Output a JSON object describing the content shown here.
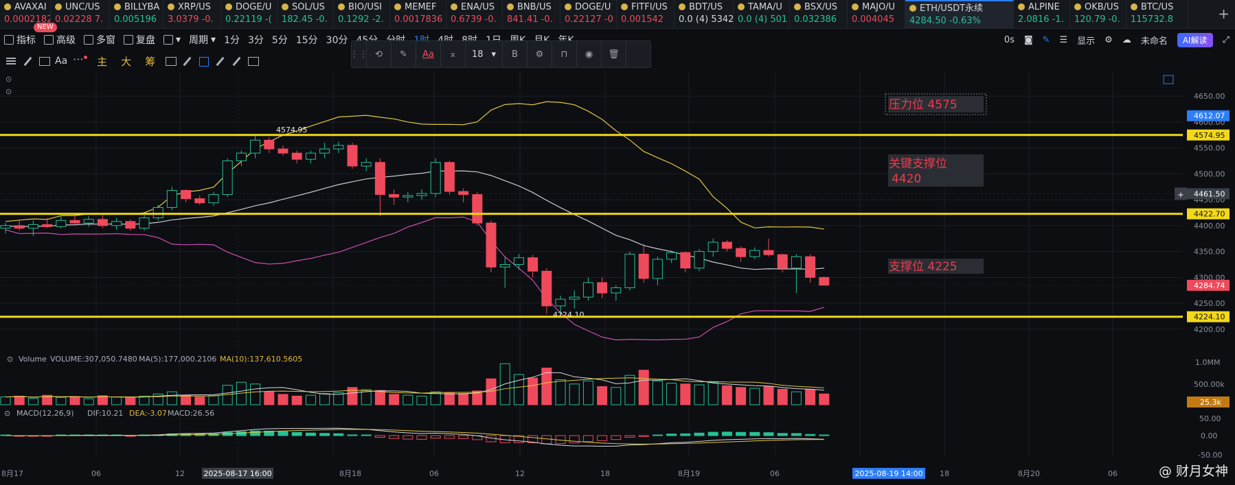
{
  "tickers": [
    {
      "symbol": "AVAXAI",
      "price": "0.0002182",
      "dir": "down",
      "width": 74
    },
    {
      "symbol": "UNC/US",
      "price": "0.02228 7.",
      "dir": "down",
      "width": 86
    },
    {
      "symbol": "BILLYBA",
      "price": "0.005196",
      "dir": "up",
      "width": 78
    },
    {
      "symbol": "XRP/US",
      "price": "3.0379 -0.",
      "dir": "down",
      "width": 84
    },
    {
      "symbol": "DOGE/U",
      "price": "0.22119 -(",
      "dir": "up",
      "width": 82
    },
    {
      "symbol": "SOL/US",
      "price": "182.45 -0.",
      "dir": "up",
      "width": 82
    },
    {
      "symbol": "BIO/USI",
      "price": "0.1292 -2.",
      "dir": "up",
      "width": 82
    },
    {
      "symbol": "MEMEF",
      "price": "0.0017836",
      "dir": "down",
      "width": 82
    },
    {
      "symbol": "ENA/US",
      "price": "0.6739 -0.",
      "dir": "down",
      "width": 82
    },
    {
      "symbol": "BNB/US",
      "price": "841.41 -0.",
      "dir": "down",
      "width": 84
    },
    {
      "symbol": "DOGE/U",
      "price": "0.22127 -0",
      "dir": "down",
      "width": 82
    },
    {
      "symbol": "FITFI/US",
      "price": "0.001542",
      "dir": "down",
      "width": 84
    },
    {
      "symbol": "BDT/US",
      "price": "0.0 (4) 5342",
      "dir": "flat",
      "width": 86
    },
    {
      "symbol": "TAMA/U",
      "price": "0.0 (4) 501",
      "dir": "up",
      "width": 82
    },
    {
      "symbol": "BSX/US",
      "price": "0.032386",
      "dir": "up",
      "width": 84
    },
    {
      "symbol": "MAJO/U",
      "price": "0.004045",
      "dir": "down",
      "width": 84
    },
    {
      "symbol": "ETH/USDT永续",
      "price": "4284.50 -0.63%",
      "dir": "active",
      "width": 158
    },
    {
      "symbol": "ALPINE",
      "price": "2.0816 -1.",
      "dir": "up",
      "width": 82
    },
    {
      "symbol": "OKB/US",
      "price": "120.79 -0.",
      "dir": "up",
      "width": 82
    },
    {
      "symbol": "BTC/US",
      "price": "115732.8",
      "dir": "up",
      "width": 90
    }
  ],
  "toolbar1": {
    "new_badge": "NEW",
    "indicators": "指标",
    "advanced": "高级",
    "multi_window": "多窗",
    "replay": "复盘",
    "period_label": "周期",
    "periods": [
      "1分",
      "3分",
      "5分",
      "15分",
      "30分",
      "45分",
      "分时",
      "1时",
      "4时",
      "8时",
      "1日",
      "周K",
      "月K",
      "年K"
    ],
    "selected_period": "1时",
    "countdown": "0s",
    "display": "显示",
    "unnamed": "未命名",
    "ai_button": "AI解读"
  },
  "toolbar2": {
    "aa": "Aa",
    "ind_main": "主",
    "ind_big": "大",
    "ind_chip": "筹"
  },
  "float_toolbar": {
    "aa": "Aa",
    "font_size": "18",
    "bold": "B"
  },
  "price_axis": {
    "ticks": [
      "4650.00",
      "4600.00",
      "4550.00",
      "4500.00",
      "4450.00",
      "4400.00",
      "4350.00",
      "4300.00",
      "4250.00",
      "4200.00"
    ],
    "tags": [
      {
        "label": "4612.07",
        "color": "#2d7ef7",
        "value": 4612.07
      },
      {
        "label": "4574.95",
        "color": "#f2d81a",
        "value": 4574.95
      },
      {
        "label": "4461.50",
        "color": "#3a3f47",
        "value": 4461.5
      },
      {
        "label": "4422.70",
        "color": "#f2d81a",
        "value": 4422.7
      },
      {
        "label": "4284.74",
        "color": "#ef4a5c",
        "value": 4284.74
      },
      {
        "label": "4224.10",
        "color": "#f2d81a",
        "value": 4224.1
      }
    ]
  },
  "annotations": {
    "resistance": "压力位  4575",
    "key_support_1": "关键支撑位",
    "key_support_2": "4420",
    "support": "支撑位  4225",
    "high_label": "4574.95",
    "low_label": "4224.10"
  },
  "volume_pane": {
    "title": "Volume",
    "volume": "VOLUME:307,050.7480",
    "ma5": "MA(5):177,000.2106",
    "ma10": "MA(10):137,610.5605",
    "ticks": [
      "1.0MM",
      "500.00k"
    ],
    "current_tag": "25.3k"
  },
  "macd_pane": {
    "title": "MACD(12,26,9)",
    "dif": "DIF:10.21",
    "dea": "DEA:-3.07",
    "macd": "MACD:26.56",
    "ticks": [
      "50.00",
      "0.00",
      "-50.00"
    ]
  },
  "time_axis": {
    "labels": [
      "8月17",
      "06",
      "12",
      "8月18",
      "06",
      "12",
      "18",
      "8月19",
      "06",
      "18",
      "8月20",
      "06"
    ],
    "crosshair_label": "2025-08-17 16:00",
    "current_label": "2025-08-19 14:00"
  },
  "watermark": "@ 财月女神",
  "chart_data": {
    "type": "candlestick",
    "interval": "1h",
    "symbol": "ETH/USDT永续",
    "ylim": [
      4180,
      4670
    ],
    "horizontal_levels": [
      4574.95,
      4422.7,
      4224.1
    ],
    "candles": [
      [
        4395,
        4405,
        4385,
        4400
      ],
      [
        4400,
        4412,
        4390,
        4395
      ],
      [
        4395,
        4410,
        4380,
        4402
      ],
      [
        4402,
        4415,
        4395,
        4398
      ],
      [
        4398,
        4420,
        4395,
        4410
      ],
      [
        4410,
        4425,
        4400,
        4405
      ],
      [
        4405,
        4418,
        4398,
        4412
      ],
      [
        4412,
        4420,
        4395,
        4400
      ],
      [
        4400,
        4415,
        4392,
        4408
      ],
      [
        4408,
        4412,
        4390,
        4395
      ],
      [
        4395,
        4420,
        4390,
        4415
      ],
      [
        4415,
        4440,
        4410,
        4435
      ],
      [
        4435,
        4475,
        4430,
        4468
      ],
      [
        4468,
        4470,
        4445,
        4452
      ],
      [
        4452,
        4458,
        4440,
        4444
      ],
      [
        4444,
        4465,
        4438,
        4460
      ],
      [
        4460,
        4530,
        4455,
        4525
      ],
      [
        4525,
        4545,
        4515,
        4540
      ],
      [
        4540,
        4575,
        4530,
        4565
      ],
      [
        4565,
        4570,
        4540,
        4548
      ],
      [
        4548,
        4555,
        4535,
        4540
      ],
      [
        4540,
        4545,
        4520,
        4528
      ],
      [
        4528,
        4545,
        4520,
        4540
      ],
      [
        4540,
        4560,
        4530,
        4548
      ],
      [
        4548,
        4562,
        4540,
        4555
      ],
      [
        4555,
        4560,
        4510,
        4515
      ],
      [
        4515,
        4530,
        4505,
        4522
      ],
      [
        4522,
        4530,
        4418,
        4460
      ],
      [
        4460,
        4470,
        4440,
        4455
      ],
      [
        4455,
        4465,
        4445,
        4458
      ],
      [
        4458,
        4470,
        4450,
        4462
      ],
      [
        4462,
        4530,
        4455,
        4522
      ],
      [
        4522,
        4525,
        4460,
        4466
      ],
      [
        4466,
        4472,
        4445,
        4460
      ],
      [
        4460,
        4465,
        4400,
        4405
      ],
      [
        4405,
        4410,
        4310,
        4320
      ],
      [
        4320,
        4340,
        4280,
        4325
      ],
      [
        4325,
        4345,
        4315,
        4338
      ],
      [
        4338,
        4344,
        4300,
        4312
      ],
      [
        4312,
        4318,
        4230,
        4245
      ],
      [
        4245,
        4265,
        4224,
        4258
      ],
      [
        4258,
        4275,
        4240,
        4262
      ],
      [
        4262,
        4300,
        4255,
        4290
      ],
      [
        4290,
        4300,
        4260,
        4270
      ],
      [
        4270,
        4285,
        4255,
        4280
      ],
      [
        4280,
        4350,
        4275,
        4345
      ],
      [
        4345,
        4365,
        4290,
        4298
      ],
      [
        4298,
        4340,
        4285,
        4335
      ],
      [
        4335,
        4352,
        4328,
        4348
      ],
      [
        4348,
        4350,
        4310,
        4318
      ],
      [
        4318,
        4355,
        4312,
        4350
      ],
      [
        4350,
        4375,
        4340,
        4368
      ],
      [
        4368,
        4372,
        4350,
        4356
      ],
      [
        4356,
        4360,
        4330,
        4340
      ],
      [
        4340,
        4358,
        4335,
        4352
      ],
      [
        4352,
        4375,
        4340,
        4344
      ],
      [
        4344,
        4346,
        4310,
        4318
      ],
      [
        4318,
        4345,
        4270,
        4340
      ],
      [
        4340,
        4345,
        4290,
        4300
      ],
      [
        4300,
        4302,
        4284,
        4285
      ]
    ],
    "volume": [
      18,
      20,
      15,
      22,
      17,
      19,
      14,
      21,
      18,
      16,
      20,
      25,
      30,
      22,
      18,
      21,
      45,
      52,
      48,
      30,
      24,
      20,
      22,
      26,
      28,
      40,
      35,
      33,
      24,
      22,
      20,
      30,
      28,
      26,
      32,
      60,
      95,
      70,
      62,
      85,
      58,
      48,
      55,
      42,
      40,
      68,
      80,
      55,
      50,
      48,
      46,
      52,
      44,
      40,
      38,
      42,
      36,
      30,
      35,
      25
    ],
    "volume_colors": "red=down, green=up"
  }
}
